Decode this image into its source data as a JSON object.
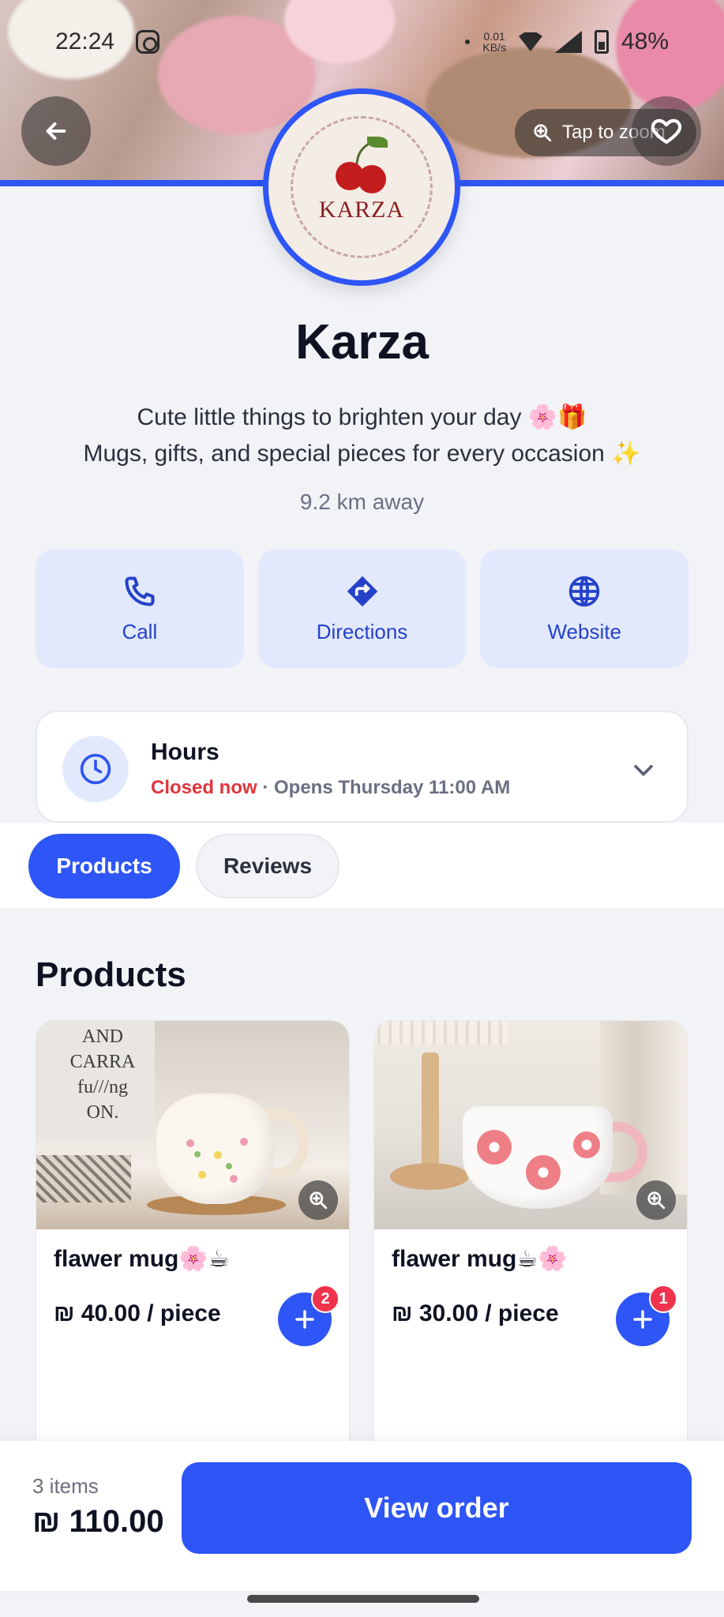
{
  "status_bar": {
    "time": "22:24",
    "net_speed": "0.01",
    "net_unit": "KB/s",
    "battery": "48%"
  },
  "header": {
    "zoom_label": "Tap to zoom",
    "logo_text": "KARZA"
  },
  "store": {
    "name": "Karza",
    "description_line1": "Cute little things to brighten your day 🌸🎁",
    "description_line2": "Mugs, gifts, and special pieces for every occasion ✨",
    "distance": "9.2 km away"
  },
  "actions": [
    {
      "label": "Call",
      "icon": "phone-icon"
    },
    {
      "label": "Directions",
      "icon": "directions-icon"
    },
    {
      "label": "Website",
      "icon": "globe-icon"
    }
  ],
  "hours": {
    "title": "Hours",
    "status": "Closed now",
    "next_open": " · Opens Thursday 11:00 AM"
  },
  "tabs": [
    {
      "label": "Products",
      "active": true
    },
    {
      "label": "Reviews",
      "active": false
    }
  ],
  "products_section": {
    "title": "Products",
    "items": [
      {
        "name": "flawer mug🌸☕",
        "price": "₪ 40.00 / piece",
        "in_cart": "2",
        "sign_text": "AND CARRA fu///ng ON."
      },
      {
        "name": "flawer mug☕🌸",
        "price": "₪ 30.00 / piece",
        "in_cart": "1"
      }
    ]
  },
  "order": {
    "count": "3 items",
    "total": "₪ 110.00",
    "button": "View order"
  },
  "colors": {
    "accent": "#2e55f5",
    "accent_soft": "#e3e9fd",
    "closed": "#e0353a",
    "badge": "#f0334d"
  }
}
